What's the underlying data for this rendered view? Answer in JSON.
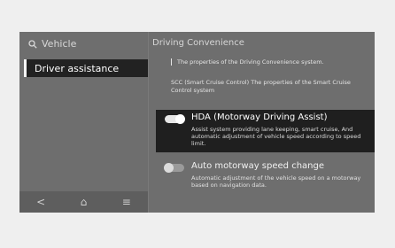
{
  "sidebar": {
    "search_label": "Vehicle",
    "items": [
      {
        "label": "Driver assistance",
        "selected": true
      }
    ]
  },
  "bottom_nav": {
    "back_glyph": "<",
    "home_glyph": "⌂",
    "menu_glyph": "≡"
  },
  "content": {
    "title": "Driving Convenience",
    "description": "The properties of the Driving Convenience system.",
    "scc_description": "SCC (Smart Cruise Control) The properties of the Smart Cruise Control system",
    "options": [
      {
        "title": "HDA (Motorway Driving Assist)",
        "description": "Assist system providing lane keeping, smart cruise, And automatic adjustment of vehicle speed according to speed limit.",
        "enabled": true,
        "highlighted": true
      },
      {
        "title": "Auto motorway speed change",
        "description": "Automatic adjustment of the vehicle speed on a motorway based on navigation data.",
        "enabled": false,
        "highlighted": false
      }
    ]
  }
}
